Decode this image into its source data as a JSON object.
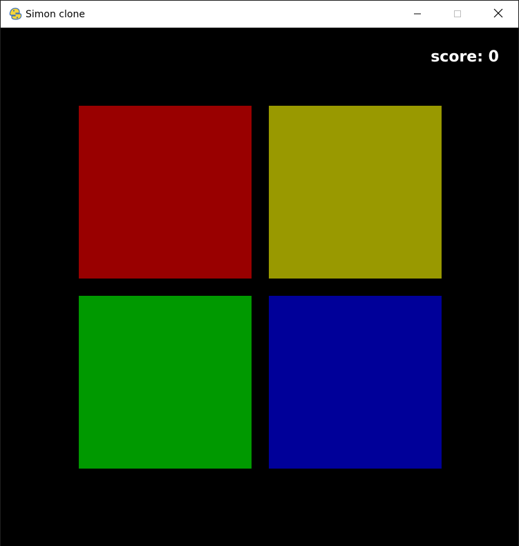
{
  "window": {
    "title": "Simon clone",
    "icon": "pygame-snake-icon"
  },
  "controls": {
    "minimize_icon": "minimize-icon",
    "maximize_icon": "maximize-icon",
    "close_icon": "close-icon"
  },
  "hud": {
    "score_text": "score: 0"
  },
  "pads": [
    {
      "color_name": "red",
      "color": "#990000"
    },
    {
      "color_name": "yellow",
      "color": "#999900"
    },
    {
      "color_name": "green",
      "color": "#009900"
    },
    {
      "color_name": "blue",
      "color": "#000099"
    }
  ],
  "colors": {
    "background": "#000000",
    "text": "#ffffff"
  }
}
